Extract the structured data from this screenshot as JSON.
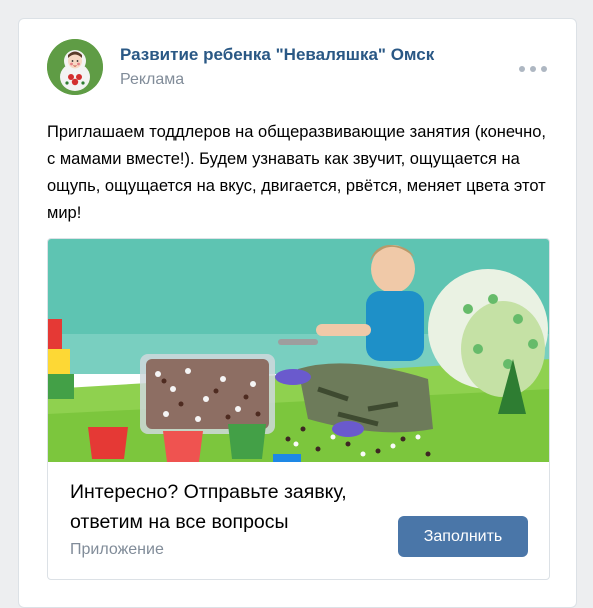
{
  "post": {
    "author": "Развитие ребенка \"Неваляшка\" Омск",
    "label": "Реклама",
    "text": "Приглашаем тоддлеров на общеразвивающие занятия (конечно, с мамами вместе!). Будем узнавать как звучит, ощущается на ощупь, ощущается на вкус, двигается, рвётся, меняет цвета этот мир!",
    "more_icon": "more-horizontal-icon"
  },
  "attachment": {
    "title": "Интересно? Отправьте заявку, ответим на все вопросы",
    "caption": "Приложение",
    "button_label": "Заполнить"
  },
  "colors": {
    "link": "#2a5885",
    "muted": "#818c99",
    "button": "#4a76a8",
    "background": "#edeef0"
  }
}
